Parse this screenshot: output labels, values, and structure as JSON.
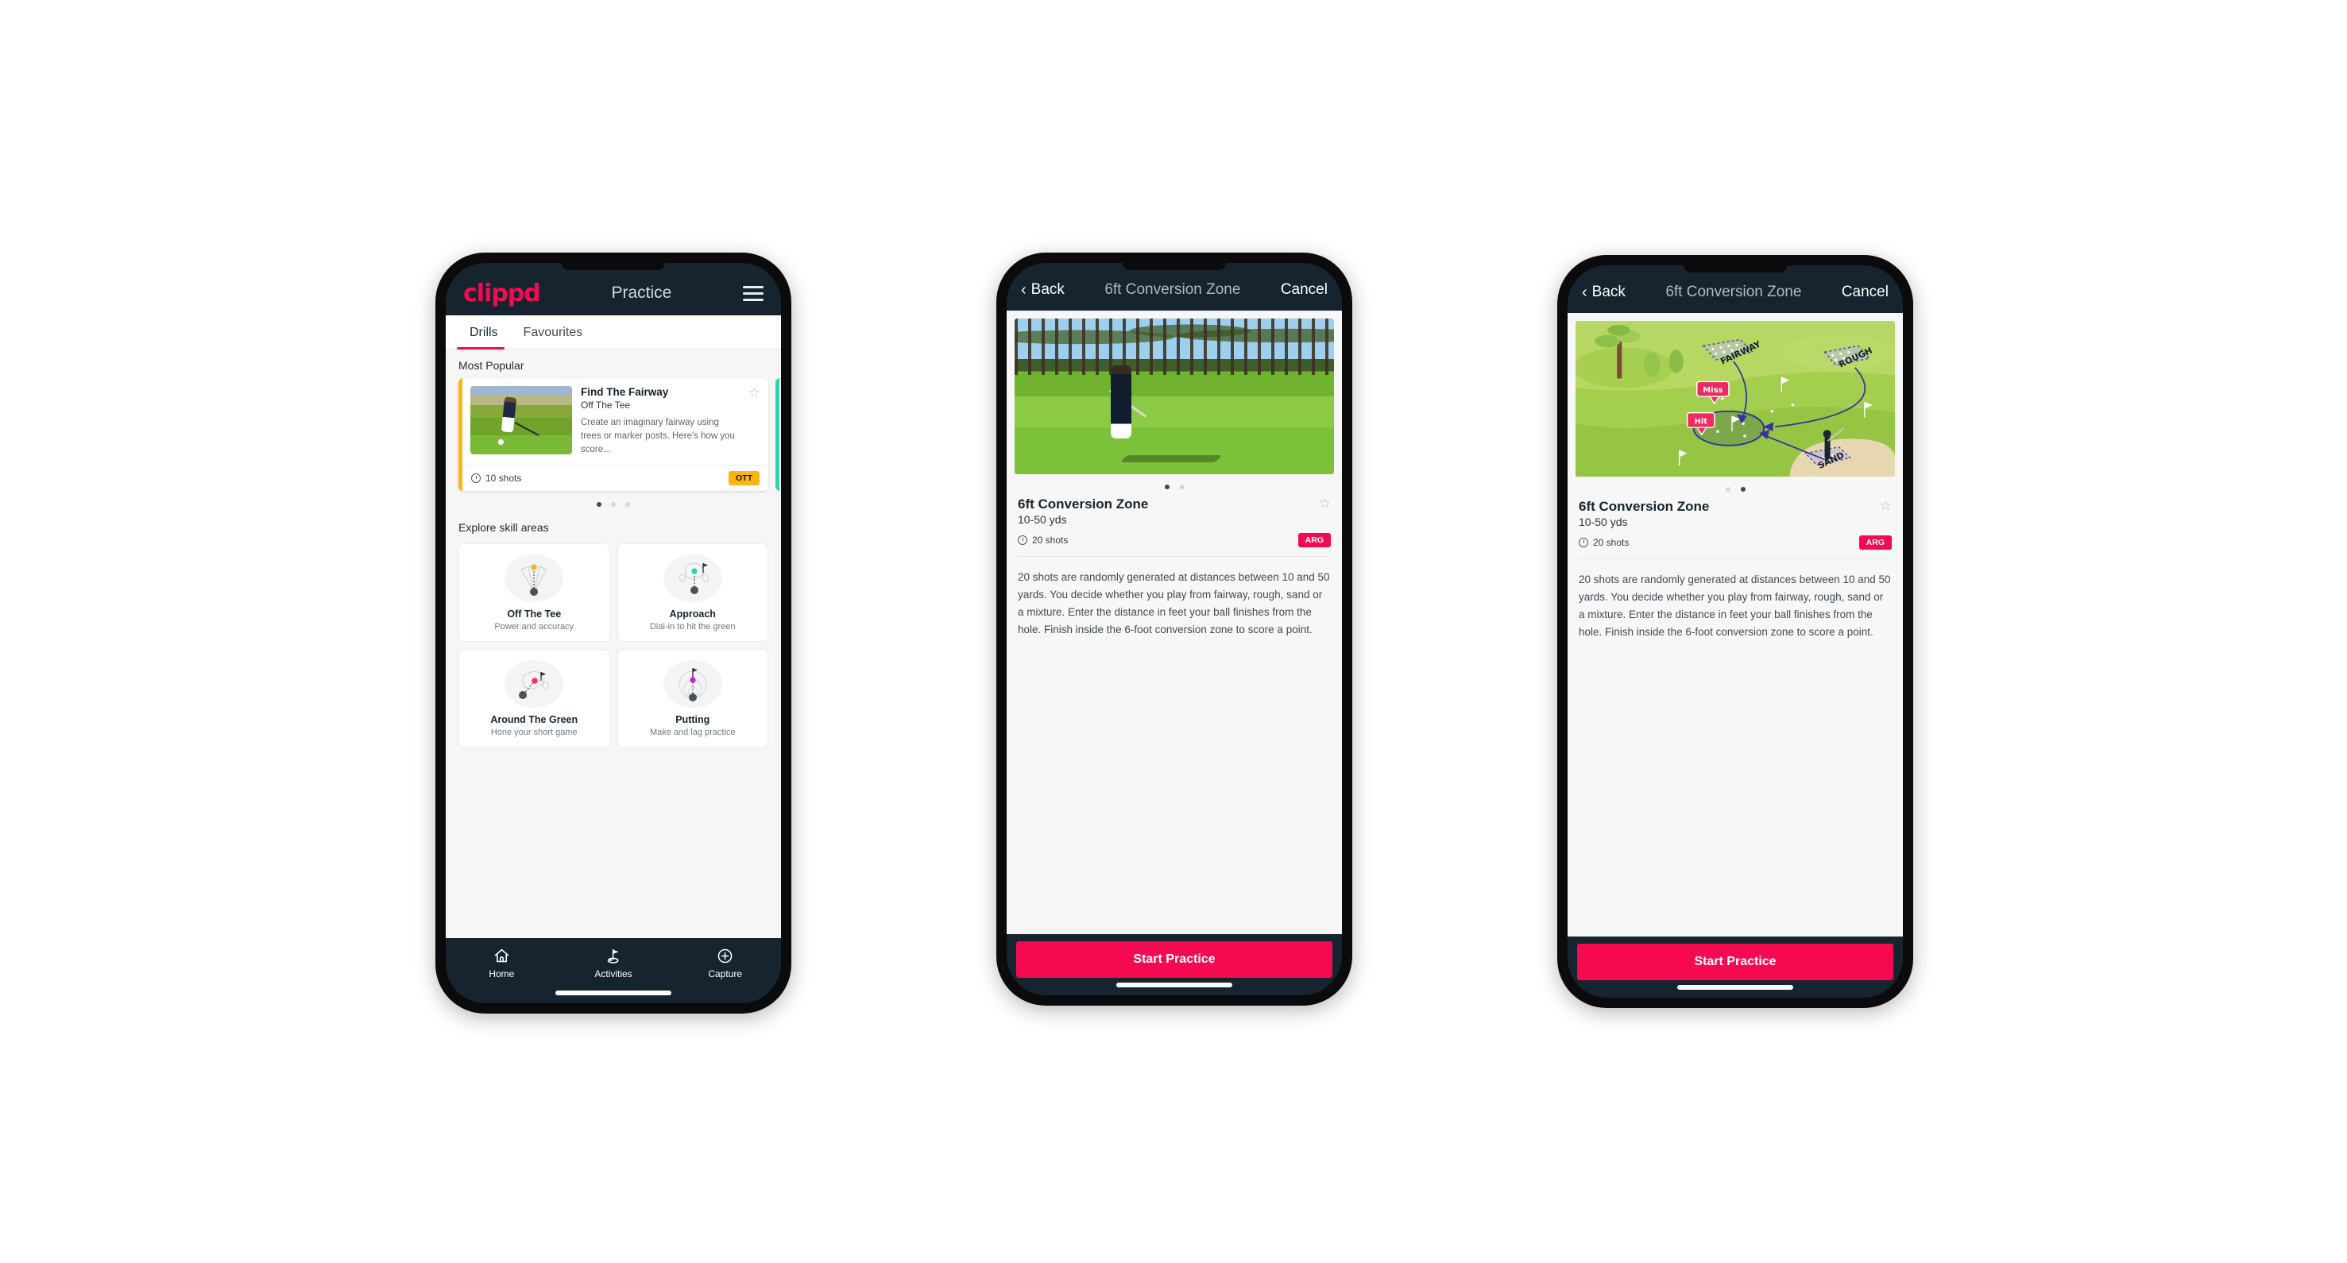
{
  "app": {
    "brand": "clippd",
    "accent_pink": "#f50a52",
    "accent_dark": "#15242e",
    "accent_yellow": "#fcb415",
    "accent_teal": "#2ad3b4"
  },
  "phone1": {
    "appbar": {
      "title": "Practice",
      "menu_icon": "hamburger-menu-icon"
    },
    "tabs": [
      {
        "label": "Drills",
        "active": true
      },
      {
        "label": "Favourites",
        "active": false
      }
    ],
    "most_popular_label": "Most Popular",
    "drill_card": {
      "title": "Find The Fairway",
      "subtitle": "Off The Tee",
      "description": "Create an imaginary fairway using trees or marker posts. Here's how you score...",
      "shots": "10 shots",
      "badge": "OTT",
      "favourite_icon": "star-outline-icon"
    },
    "carousel_dots": {
      "count": 3,
      "active_index": 0
    },
    "explore_label": "Explore skill areas",
    "skills": [
      {
        "name": "Off The Tee",
        "sub": "Power and accuracy",
        "icon": "tee-shot-fan-icon",
        "dot_color": "#fcb415"
      },
      {
        "name": "Approach",
        "sub": "Dial-in to hit the green",
        "icon": "approach-green-icon",
        "dot_color": "#2ad3b4"
      },
      {
        "name": "Around The Green",
        "sub": "Hone your short game",
        "icon": "around-green-icon",
        "dot_color": "#f5356e"
      },
      {
        "name": "Putting",
        "sub": "Make and lag practice",
        "icon": "putting-rings-icon",
        "dot_color": "#c21fd6"
      }
    ],
    "tabbar": [
      {
        "label": "Home",
        "icon": "home-icon"
      },
      {
        "label": "Activities",
        "icon": "golf-flag-icon"
      },
      {
        "label": "Capture",
        "icon": "plus-circle-icon"
      }
    ]
  },
  "phone2": {
    "navbar": {
      "back": "Back",
      "title": "6ft Conversion Zone",
      "cancel": "Cancel",
      "back_icon": "chevron-left-icon"
    },
    "hero": {
      "type": "photo",
      "alt": "golfer-chipping-photo"
    },
    "carousel_dots": {
      "count": 2,
      "active_index": 0
    },
    "title": "6ft Conversion Zone",
    "distance": "10-50 yds",
    "shots": "20 shots",
    "badge": "ARG",
    "favourite_icon": "star-outline-icon",
    "description": "20 shots are randomly generated at distances between 10 and 50 yards. You decide whether you play from fairway, rough, sand or a mixture. Enter the distance in feet your ball finishes from the hole. Finish inside the 6-foot conversion zone to score a point.",
    "cta": "Start Practice"
  },
  "phone3": {
    "navbar": {
      "back": "Back",
      "title": "6ft Conversion Zone",
      "cancel": "Cancel",
      "back_icon": "chevron-left-icon"
    },
    "hero": {
      "type": "illustration",
      "labels": [
        "FAIRWAY",
        "ROUGH",
        "SAND"
      ],
      "markers": [
        "Miss",
        "Hit"
      ]
    },
    "carousel_dots": {
      "count": 2,
      "active_index": 1
    },
    "title": "6ft Conversion Zone",
    "distance": "10-50 yds",
    "shots": "20 shots",
    "badge": "ARG",
    "favourite_icon": "star-outline-icon",
    "description": "20 shots are randomly generated at distances between 10 and 50 yards. You decide whether you play from fairway, rough, sand or a mixture. Enter the distance in feet your ball finishes from the hole. Finish inside the 6-foot conversion zone to score a point.",
    "cta": "Start Practice"
  }
}
